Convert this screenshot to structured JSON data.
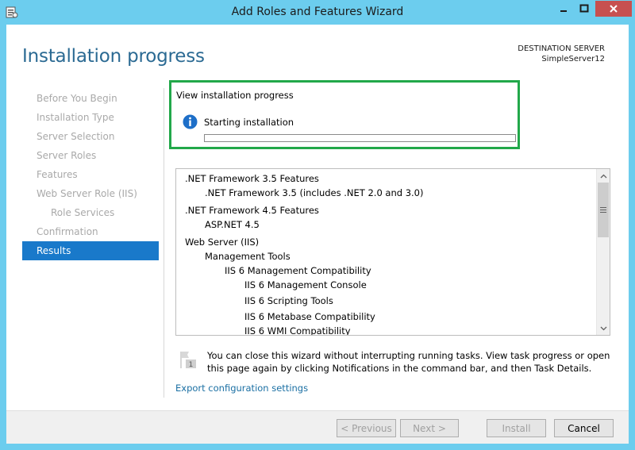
{
  "window": {
    "title": "Add Roles and Features Wizard"
  },
  "header": {
    "page_title": "Installation progress",
    "destination_label": "DESTINATION SERVER",
    "destination_server": "SimpleServer12"
  },
  "nav": {
    "items": [
      {
        "label": "Before You Begin",
        "state": "disabled",
        "indent": false
      },
      {
        "label": "Installation Type",
        "state": "disabled",
        "indent": false
      },
      {
        "label": "Server Selection",
        "state": "disabled",
        "indent": false
      },
      {
        "label": "Server Roles",
        "state": "disabled",
        "indent": false
      },
      {
        "label": "Features",
        "state": "disabled",
        "indent": false
      },
      {
        "label": "Web Server Role (IIS)",
        "state": "disabled",
        "indent": false
      },
      {
        "label": "Role Services",
        "state": "disabled",
        "indent": true
      },
      {
        "label": "Confirmation",
        "state": "disabled",
        "indent": false
      },
      {
        "label": "Results",
        "state": "active",
        "indent": false
      }
    ]
  },
  "progress": {
    "header": "View installation progress",
    "status": "Starting installation",
    "percent": 0
  },
  "features": [
    {
      "label": ".NET Framework 3.5 Features",
      "level": 0
    },
    {
      "label": ".NET Framework 3.5 (includes .NET 2.0 and 3.0)",
      "level": 1
    },
    {
      "label": ".NET Framework 4.5 Features",
      "level": 0
    },
    {
      "label": "ASP.NET 4.5",
      "level": 1
    },
    {
      "label": "Web Server (IIS)",
      "level": 0
    },
    {
      "label": "Management Tools",
      "level": 1
    },
    {
      "label": "IIS 6 Management Compatibility",
      "level": 2
    },
    {
      "label": "IIS 6 Management Console",
      "level": 3
    },
    {
      "label": "IIS 6 Scripting Tools",
      "level": 3
    },
    {
      "label": "IIS 6 Metabase Compatibility",
      "level": 3
    },
    {
      "label": "IIS 6 WMI Compatibility",
      "level": 3
    }
  ],
  "note": {
    "text": "You can close this wizard without interrupting running tasks. View task progress or open this page again by clicking Notifications in the command bar, and then Task Details.",
    "badge": "1"
  },
  "export_link": "Export configuration settings",
  "buttons": {
    "previous": "< Previous",
    "next": "Next >",
    "install": "Install",
    "cancel": "Cancel"
  },
  "colors": {
    "accent": "#1979ca",
    "title_blue": "#2b6a93",
    "highlight_green": "#22a84a",
    "window_frame": "#6ccdee",
    "close_button": "#c75050"
  }
}
